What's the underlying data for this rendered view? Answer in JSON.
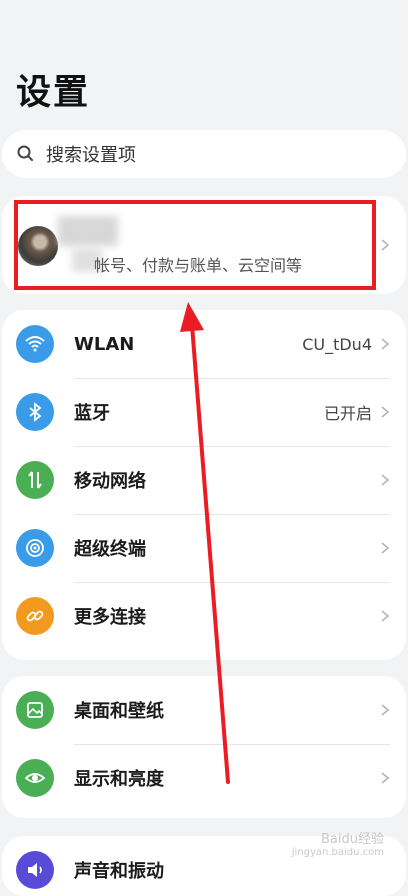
{
  "page": {
    "title": "设置"
  },
  "search": {
    "placeholder": "搜索设置项"
  },
  "account": {
    "subtitle": "帐号、付款与账单、云空间等"
  },
  "groups": [
    {
      "items": [
        {
          "label": "WLAN",
          "value": "CU_tDu4",
          "icon": "wifi-icon",
          "color": "#3a9ce8"
        },
        {
          "label": "蓝牙",
          "value": "已开启",
          "icon": "bluetooth-icon",
          "color": "#3a9ce8"
        },
        {
          "label": "移动网络",
          "value": "",
          "icon": "mobile-network-icon",
          "color": "#4aae54"
        },
        {
          "label": "超级终端",
          "value": "",
          "icon": "super-device-icon",
          "color": "#3a9ce8"
        },
        {
          "label": "更多连接",
          "value": "",
          "icon": "link-icon",
          "color": "#f29a1f"
        }
      ]
    },
    {
      "items": [
        {
          "label": "桌面和壁纸",
          "value": "",
          "icon": "wallpaper-icon",
          "color": "#4aae54"
        },
        {
          "label": "显示和亮度",
          "value": "",
          "icon": "eye-icon",
          "color": "#4aae54"
        }
      ]
    },
    {
      "items": [
        {
          "label": "声音和振动",
          "value": "",
          "icon": "sound-icon",
          "color": "#5a4ad8"
        }
      ]
    }
  ],
  "watermark": {
    "line1": "Baidu经验",
    "line2": "jingyan.baidu.com"
  }
}
